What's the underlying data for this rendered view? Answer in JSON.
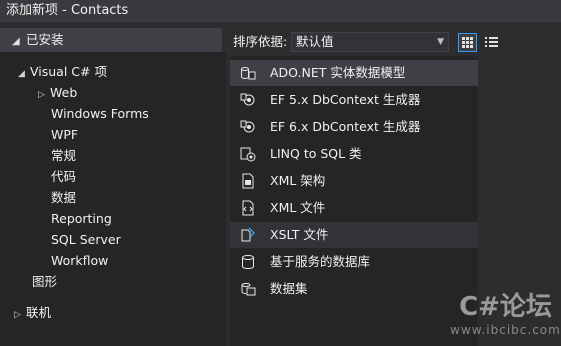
{
  "window": {
    "title": "添加新项 - Contacts"
  },
  "left": {
    "header": "已安装",
    "tree": [
      {
        "label": "Visual C# 项",
        "expander": "▲"
      },
      {
        "label": "Web",
        "expander": "▷"
      },
      {
        "label": "Windows Forms",
        "expander": ""
      },
      {
        "label": "WPF",
        "expander": ""
      },
      {
        "label": "常规",
        "expander": ""
      },
      {
        "label": "代码",
        "expander": ""
      },
      {
        "label": "数据",
        "expander": ""
      },
      {
        "label": "Reporting",
        "expander": ""
      },
      {
        "label": "SQL Server",
        "expander": ""
      },
      {
        "label": "Workflow",
        "expander": ""
      },
      {
        "label": "图形",
        "expander": ""
      },
      {
        "label": "联机",
        "expander": "▷"
      }
    ]
  },
  "sortbar": {
    "label": "排序依据:",
    "selected": "默认值"
  },
  "items": [
    {
      "label": "ADO.NET 实体数据模型",
      "icon": "ado-net-model-icon"
    },
    {
      "label": "EF 5.x DbContext 生成器",
      "icon": "ef-generator-icon"
    },
    {
      "label": "EF 6.x DbContext 生成器",
      "icon": "ef-generator-icon"
    },
    {
      "label": "LINQ to SQL 类",
      "icon": "linq-to-sql-icon"
    },
    {
      "label": "XML 架构",
      "icon": "xml-schema-icon"
    },
    {
      "label": "XML 文件",
      "icon": "xml-file-icon"
    },
    {
      "label": "XSLT 文件",
      "icon": "xslt-file-icon"
    },
    {
      "label": "基于服务的数据库",
      "icon": "database-icon"
    },
    {
      "label": "数据集",
      "icon": "dataset-icon"
    }
  ],
  "watermark": {
    "big": "C#论坛",
    "small": "www.ibcibc.com"
  },
  "colors": {
    "accent": "#3399ff",
    "selected_bg": "#3f3f46",
    "pane_bg": "#252526"
  }
}
